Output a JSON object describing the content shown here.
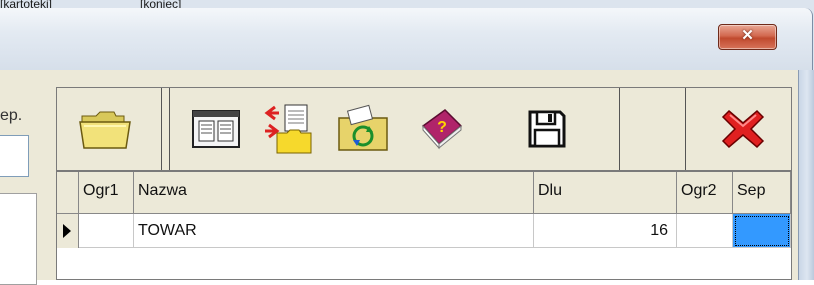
{
  "background_menu": {
    "item_1": "[kartoteki]",
    "item_2": "[koniec]"
  },
  "window": {
    "close_label": "X"
  },
  "left_panel": {
    "label": "ep."
  },
  "toolbar": {
    "icons": [
      "folder-icon",
      "card-index-icon",
      "transfer-icon",
      "refresh-folder-icon",
      "help-book-icon",
      "save-disk-icon",
      "exit-x-icon"
    ]
  },
  "grid": {
    "columns": [
      "",
      "Ogr1",
      "Nazwa",
      "Dlu",
      "Ogr2",
      "Sep"
    ],
    "rows": [
      {
        "ogr1": "",
        "nazwa": "TOWAR",
        "dlu": "16",
        "ogr2": "",
        "sep": ""
      }
    ],
    "selected_cell_color": "#3399ff"
  }
}
